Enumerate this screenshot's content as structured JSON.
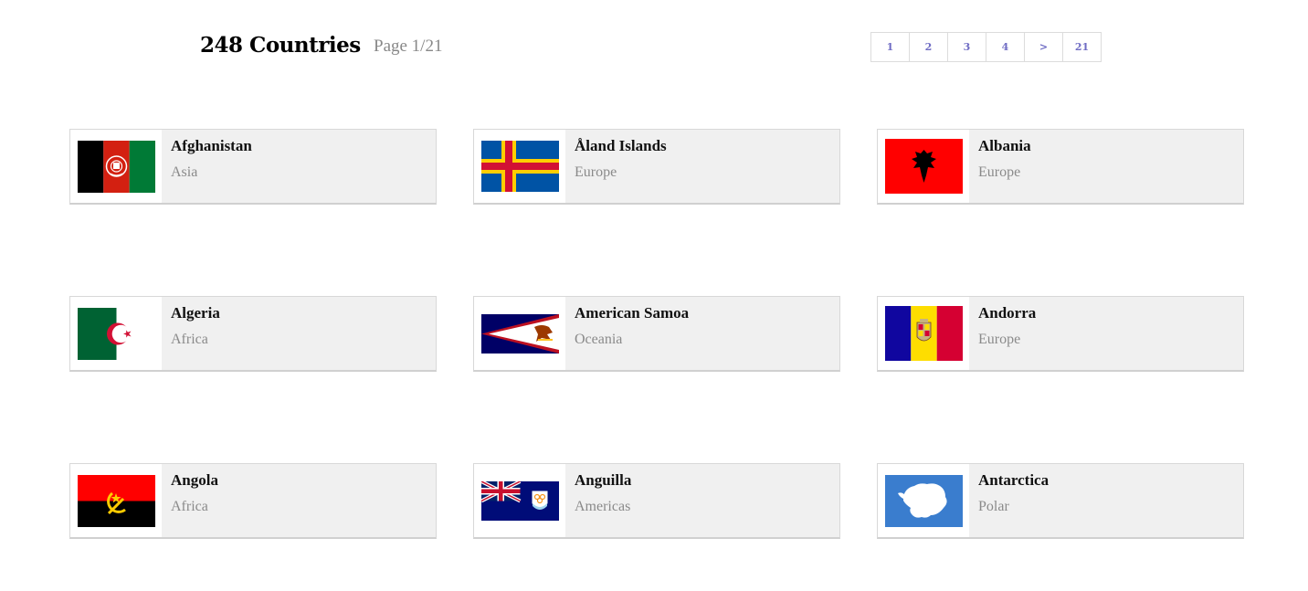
{
  "header": {
    "count_title": "248 Countries",
    "page_indicator": "Page 1/21"
  },
  "pagination": {
    "items": [
      "1",
      "2",
      "3",
      "4",
      ">",
      "21"
    ],
    "link_color": "#6f6cc4"
  },
  "countries": [
    {
      "name": "Afghanistan",
      "region": "Asia",
      "flag_icon": "afghanistan-flag"
    },
    {
      "name": "Åland Islands",
      "region": "Europe",
      "flag_icon": "aland-islands-flag"
    },
    {
      "name": "Albania",
      "region": "Europe",
      "flag_icon": "albania-flag"
    },
    {
      "name": "Algeria",
      "region": "Africa",
      "flag_icon": "algeria-flag"
    },
    {
      "name": "American Samoa",
      "region": "Oceania",
      "flag_icon": "american-samoa-flag"
    },
    {
      "name": "Andorra",
      "region": "Europe",
      "flag_icon": "andorra-flag"
    },
    {
      "name": "Angola",
      "region": "Africa",
      "flag_icon": "angola-flag"
    },
    {
      "name": "Anguilla",
      "region": "Americas",
      "flag_icon": "anguilla-flag"
    },
    {
      "name": "Antarctica",
      "region": "Polar",
      "flag_icon": "antarctica-flag"
    }
  ],
  "colors": {
    "card_background": "#f0f0f0",
    "region_text": "#8a8a8a",
    "page_indicator_text": "#888888"
  }
}
